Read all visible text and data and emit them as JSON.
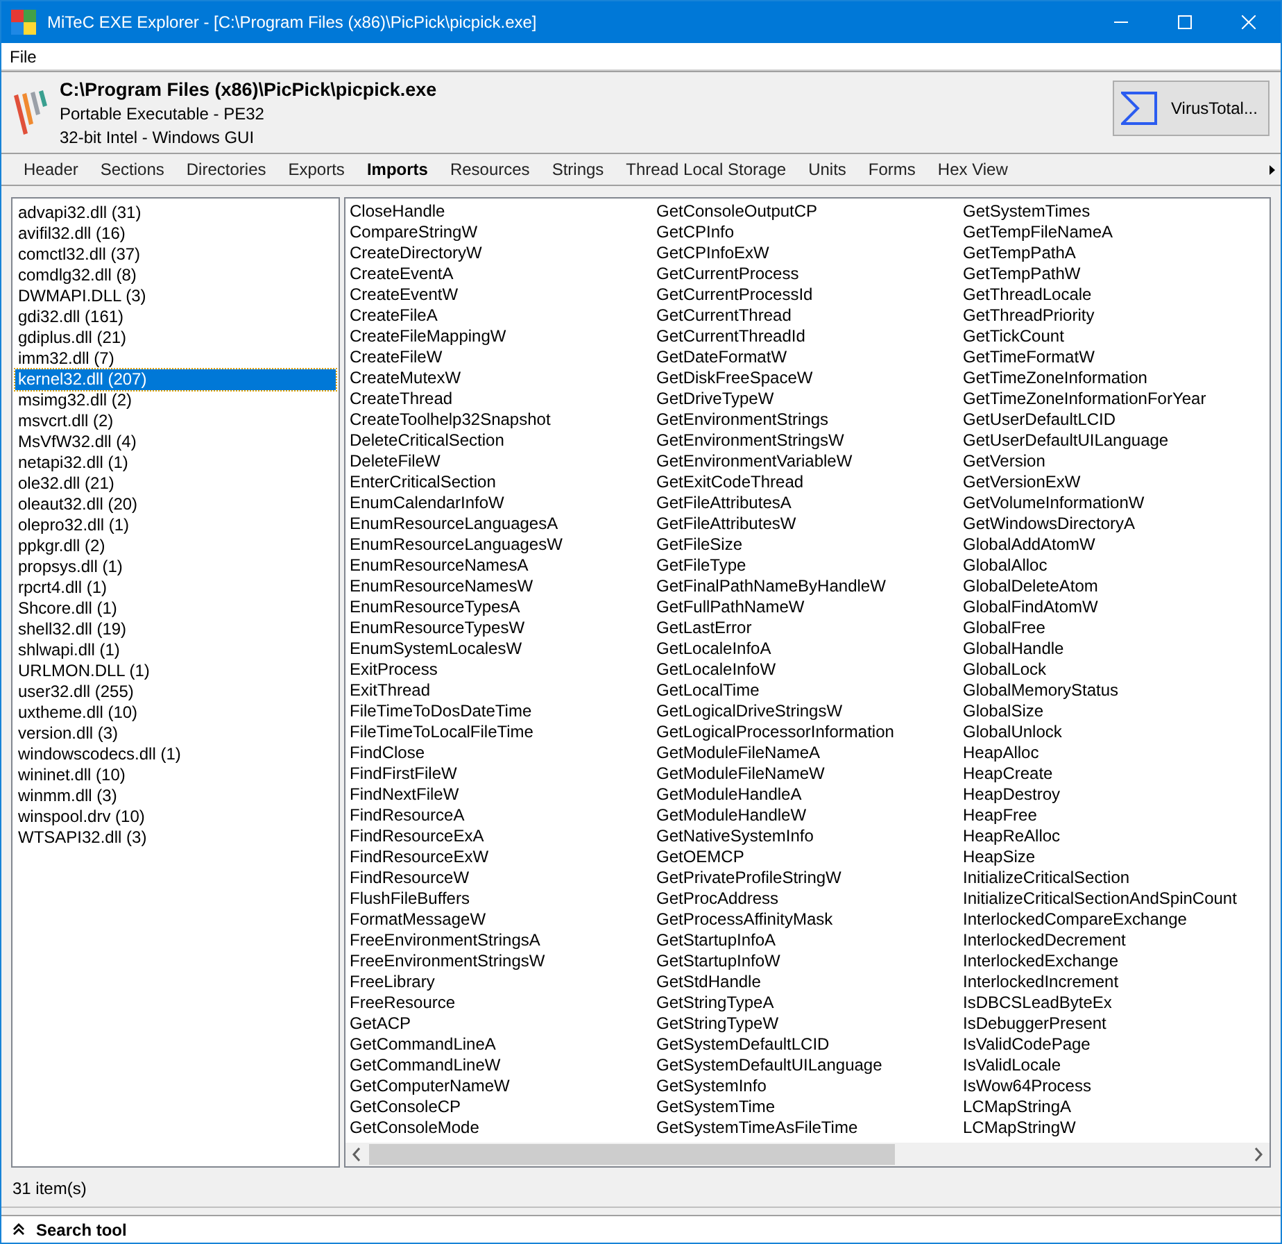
{
  "window": {
    "title": "MiTeC EXE Explorer - [C:\\Program Files (x86)\\PicPick\\picpick.exe]"
  },
  "menu": [
    "File"
  ],
  "file_info": {
    "path": "C:\\Program Files (x86)\\PicPick\\picpick.exe",
    "format": "Portable Executable - PE32",
    "platform": "32-bit Intel - Windows GUI"
  },
  "virustotal_button": "VirusTotal...",
  "tabs": [
    {
      "label": "Header",
      "selected": false
    },
    {
      "label": "Sections",
      "selected": false
    },
    {
      "label": "Directories",
      "selected": false
    },
    {
      "label": "Exports",
      "selected": false
    },
    {
      "label": "Imports",
      "selected": true
    },
    {
      "label": "Resources",
      "selected": false
    },
    {
      "label": "Strings",
      "selected": false
    },
    {
      "label": "Thread Local Storage",
      "selected": false
    },
    {
      "label": "Units",
      "selected": false
    },
    {
      "label": "Forms",
      "selected": false
    },
    {
      "label": "Hex View",
      "selected": false
    }
  ],
  "modules": [
    {
      "label": "advapi32.dll (31)",
      "selected": false
    },
    {
      "label": "avifil32.dll (16)",
      "selected": false
    },
    {
      "label": "comctl32.dll (37)",
      "selected": false
    },
    {
      "label": "comdlg32.dll (8)",
      "selected": false
    },
    {
      "label": "DWMAPI.DLL (3)",
      "selected": false
    },
    {
      "label": "gdi32.dll (161)",
      "selected": false
    },
    {
      "label": "gdiplus.dll (21)",
      "selected": false
    },
    {
      "label": "imm32.dll (7)",
      "selected": false
    },
    {
      "label": "kernel32.dll (207)",
      "selected": true
    },
    {
      "label": "msimg32.dll (2)",
      "selected": false
    },
    {
      "label": "msvcrt.dll (2)",
      "selected": false
    },
    {
      "label": "MsVfW32.dll (4)",
      "selected": false
    },
    {
      "label": "netapi32.dll (1)",
      "selected": false
    },
    {
      "label": "ole32.dll (21)",
      "selected": false
    },
    {
      "label": "oleaut32.dll (20)",
      "selected": false
    },
    {
      "label": "olepro32.dll (1)",
      "selected": false
    },
    {
      "label": "ppkgr.dll (2)",
      "selected": false
    },
    {
      "label": "propsys.dll (1)",
      "selected": false
    },
    {
      "label": "rpcrt4.dll (1)",
      "selected": false
    },
    {
      "label": "Shcore.dll (1)",
      "selected": false
    },
    {
      "label": "shell32.dll (19)",
      "selected": false
    },
    {
      "label": "shlwapi.dll (1)",
      "selected": false
    },
    {
      "label": "URLMON.DLL (1)",
      "selected": false
    },
    {
      "label": "user32.dll (255)",
      "selected": false
    },
    {
      "label": "uxtheme.dll (10)",
      "selected": false
    },
    {
      "label": "version.dll (3)",
      "selected": false
    },
    {
      "label": "windowscodecs.dll (1)",
      "selected": false
    },
    {
      "label": "wininet.dll (10)",
      "selected": false
    },
    {
      "label": "winmm.dll (3)",
      "selected": false
    },
    {
      "label": "winspool.drv (10)",
      "selected": false
    },
    {
      "label": "WTSAPI32.dll (3)",
      "selected": false
    }
  ],
  "functions": [
    [
      "CloseHandle",
      "CompareStringW",
      "CreateDirectoryW",
      "CreateEventA",
      "CreateEventW",
      "CreateFileA",
      "CreateFileMappingW",
      "CreateFileW",
      "CreateMutexW",
      "CreateThread",
      "CreateToolhelp32Snapshot",
      "DeleteCriticalSection",
      "DeleteFileW",
      "EnterCriticalSection",
      "EnumCalendarInfoW",
      "EnumResourceLanguagesA",
      "EnumResourceLanguagesW",
      "EnumResourceNamesA",
      "EnumResourceNamesW",
      "EnumResourceTypesA",
      "EnumResourceTypesW",
      "EnumSystemLocalesW",
      "ExitProcess",
      "ExitThread",
      "FileTimeToDosDateTime",
      "FileTimeToLocalFileTime",
      "FindClose",
      "FindFirstFileW",
      "FindNextFileW",
      "FindResourceA",
      "FindResourceExA",
      "FindResourceExW",
      "FindResourceW",
      "FlushFileBuffers",
      "FormatMessageW",
      "FreeEnvironmentStringsA",
      "FreeEnvironmentStringsW",
      "FreeLibrary",
      "FreeResource",
      "GetACP",
      "GetCommandLineA",
      "GetCommandLineW",
      "GetComputerNameW",
      "GetConsoleCP",
      "GetConsoleMode"
    ],
    [
      "GetConsoleOutputCP",
      "GetCPInfo",
      "GetCPInfoExW",
      "GetCurrentProcess",
      "GetCurrentProcessId",
      "GetCurrentThread",
      "GetCurrentThreadId",
      "GetDateFormatW",
      "GetDiskFreeSpaceW",
      "GetDriveTypeW",
      "GetEnvironmentStrings",
      "GetEnvironmentStringsW",
      "GetEnvironmentVariableW",
      "GetExitCodeThread",
      "GetFileAttributesA",
      "GetFileAttributesW",
      "GetFileSize",
      "GetFileType",
      "GetFinalPathNameByHandleW",
      "GetFullPathNameW",
      "GetLastError",
      "GetLocaleInfoA",
      "GetLocaleInfoW",
      "GetLocalTime",
      "GetLogicalDriveStringsW",
      "GetLogicalProcessorInformation",
      "GetModuleFileNameA",
      "GetModuleFileNameW",
      "GetModuleHandleA",
      "GetModuleHandleW",
      "GetNativeSystemInfo",
      "GetOEMCP",
      "GetPrivateProfileStringW",
      "GetProcAddress",
      "GetProcessAffinityMask",
      "GetStartupInfoA",
      "GetStartupInfoW",
      "GetStdHandle",
      "GetStringTypeA",
      "GetStringTypeW",
      "GetSystemDefaultLCID",
      "GetSystemDefaultUILanguage",
      "GetSystemInfo",
      "GetSystemTime",
      "GetSystemTimeAsFileTime"
    ],
    [
      "GetSystemTimes",
      "GetTempFileNameA",
      "GetTempPathA",
      "GetTempPathW",
      "GetThreadLocale",
      "GetThreadPriority",
      "GetTickCount",
      "GetTimeFormatW",
      "GetTimeZoneInformation",
      "GetTimeZoneInformationForYear",
      "GetUserDefaultLCID",
      "GetUserDefaultUILanguage",
      "GetVersion",
      "GetVersionExW",
      "GetVolumeInformationW",
      "GetWindowsDirectoryA",
      "GlobalAddAtomW",
      "GlobalAlloc",
      "GlobalDeleteAtom",
      "GlobalFindAtomW",
      "GlobalFree",
      "GlobalHandle",
      "GlobalLock",
      "GlobalMemoryStatus",
      "GlobalSize",
      "GlobalUnlock",
      "HeapAlloc",
      "HeapCreate",
      "HeapDestroy",
      "HeapFree",
      "HeapReAlloc",
      "HeapSize",
      "InitializeCriticalSection",
      "InitializeCriticalSectionAndSpinCount",
      "InterlockedCompareExchange",
      "InterlockedDecrement",
      "InterlockedExchange",
      "InterlockedIncrement",
      "IsDBCSLeadByteEx",
      "IsDebuggerPresent",
      "IsValidCodePage",
      "IsValidLocale",
      "IsWow64Process",
      "LCMapStringA",
      "LCMapStringW"
    ]
  ],
  "status_bar": "31 item(s)",
  "search_tool": "Search tool"
}
